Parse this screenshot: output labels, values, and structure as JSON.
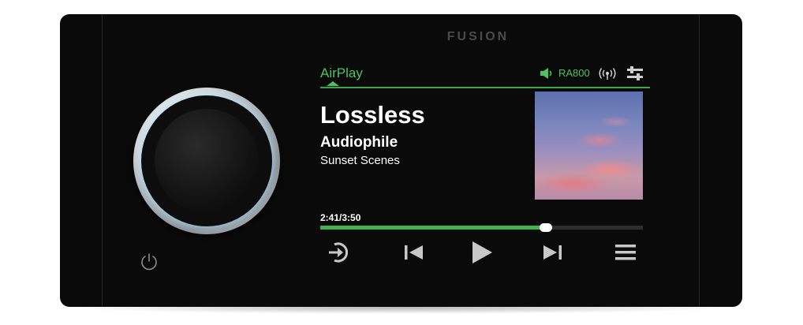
{
  "device": {
    "brand": "FUSION"
  },
  "header": {
    "source": "AirPlay",
    "zone": "RA800",
    "icons": [
      "speaker-icon",
      "signal-icon",
      "settings-icon"
    ]
  },
  "now_playing": {
    "title": "Lossless",
    "artist": "Audiophile",
    "album": "Sunset Scenes",
    "time": "2:41/3:50",
    "progress": 0.7
  },
  "controls": [
    "source-icon",
    "previous-icon",
    "play-icon",
    "next-icon",
    "menu-icon"
  ],
  "colors": {
    "accent": "#4cc45b",
    "progress": "#3fb54d",
    "knob_glow": "#6fd0ff",
    "panel": "#0a0a0a"
  }
}
